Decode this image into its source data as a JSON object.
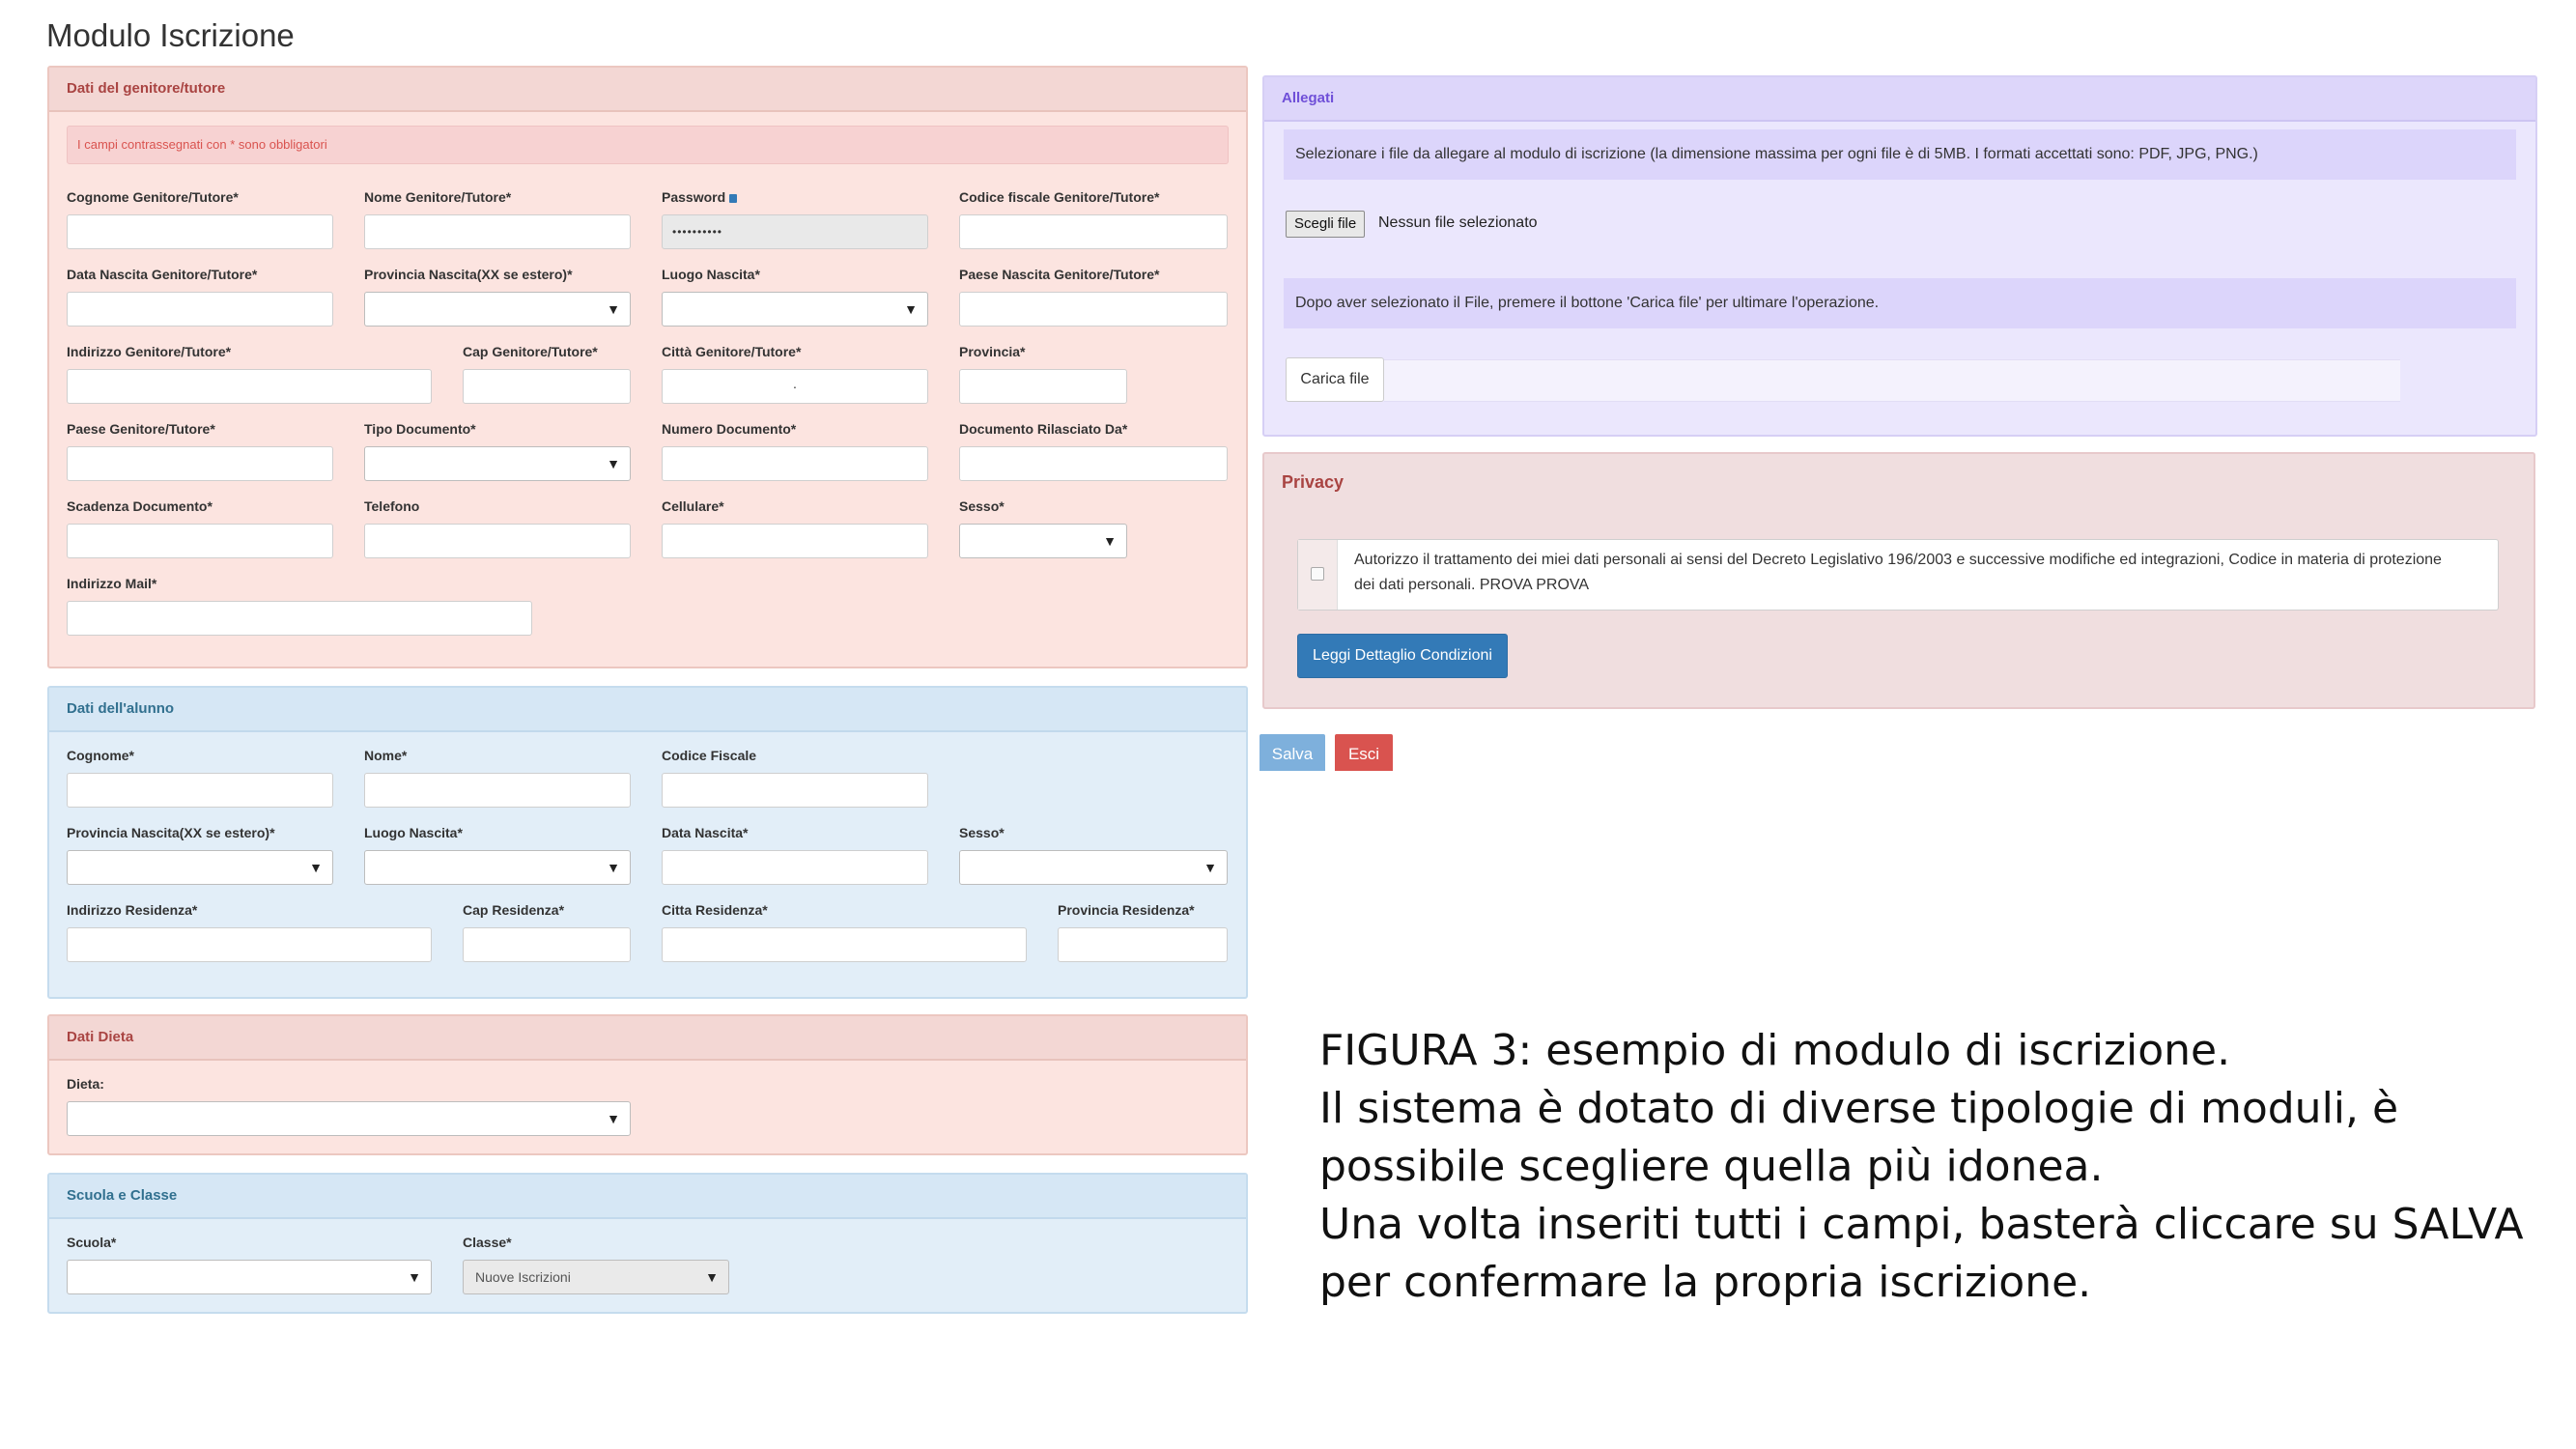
{
  "page_title": "Modulo Iscrizione",
  "genitore": {
    "title": "Dati del genitore/tutore",
    "notice": "I campi contrassegnati con * sono obbligatori",
    "fields": {
      "cognome": "Cognome Genitore/Tutore*",
      "nome": "Nome Genitore/Tutore*",
      "password": "Password",
      "password_value": "••••••••••",
      "codice_fiscale": "Codice fiscale Genitore/Tutore*",
      "data_nascita": "Data Nascita Genitore/Tutore*",
      "provincia_nascita": "Provincia Nascita(XX se estero)*",
      "luogo_nascita": "Luogo Nascita*",
      "paese_nascita": "Paese Nascita Genitore/Tutore*",
      "indirizzo": "Indirizzo Genitore/Tutore*",
      "cap": "Cap Genitore/Tutore*",
      "citta": "Città Genitore/Tutore*",
      "citta_value": "·",
      "provincia": "Provincia*",
      "paese": "Paese Genitore/Tutore*",
      "tipo_documento": "Tipo Documento*",
      "numero_documento": "Numero Documento*",
      "documento_rilasciato": "Documento Rilasciato Da*",
      "scadenza_documento": "Scadenza Documento*",
      "telefono": "Telefono",
      "cellulare": "Cellulare*",
      "sesso": "Sesso*",
      "mail": "Indirizzo Mail*"
    }
  },
  "alunno": {
    "title": "Dati dell'alunno",
    "fields": {
      "cognome": "Cognome*",
      "nome": "Nome*",
      "codice_fiscale": "Codice Fiscale",
      "provincia_nascita": "Provincia Nascita(XX se estero)*",
      "luogo_nascita": "Luogo Nascita*",
      "data_nascita": "Data Nascita*",
      "sesso": "Sesso*",
      "indirizzo": "Indirizzo Residenza*",
      "cap": "Cap Residenza*",
      "citta": "Citta Residenza*",
      "provincia": "Provincia Residenza*"
    }
  },
  "dieta": {
    "title": "Dati Dieta",
    "label": "Dieta:"
  },
  "scuola": {
    "title": "Scuola e Classe",
    "scuola_label": "Scuola*",
    "classe_label": "Classe*",
    "classe_value": "Nuove Iscrizioni"
  },
  "allegati": {
    "title": "Allegati",
    "info": "Selezionare i file da allegare al modulo di iscrizione (la dimensione massima per ogni file è di 5MB. I formati accettati sono: PDF, JPG, PNG.)",
    "choose_label": "Scegli file",
    "file_status": "Nessun file selezionato",
    "hint": "Dopo aver selezionato il File, premere il bottone 'Carica file' per ultimare l'operazione.",
    "upload_label": "Carica file"
  },
  "privacy": {
    "title": "Privacy",
    "text": "Autorizzo il trattamento dei miei dati personali ai sensi del Decreto Legislativo 196/2003 e successive modifiche ed integrazioni, Codice in materia di protezione dei dati personali. PROVA PROVA",
    "details_label": "Leggi Dettaglio Condizioni"
  },
  "actions": {
    "save_label": "Salva",
    "exit_label": "Esci"
  },
  "caption": {
    "line1": "FIGURA 3: esempio di modulo di iscrizione.",
    "line2": "Il sistema è dotato di diverse tipologie di moduli, è",
    "line3": "possibile scegliere quella più idonea.",
    "line4": "Una volta inseriti tutti i campi, basterà cliccare su SALVA",
    "line5": "per confermare la propria iscrizione."
  },
  "colors": {
    "danger_panel": "#fce4e0",
    "info_panel": "#e2eef8",
    "attachments_panel": "#ebe7fd",
    "primary_button": "#337ab7",
    "exit_button": "#d9534f"
  }
}
